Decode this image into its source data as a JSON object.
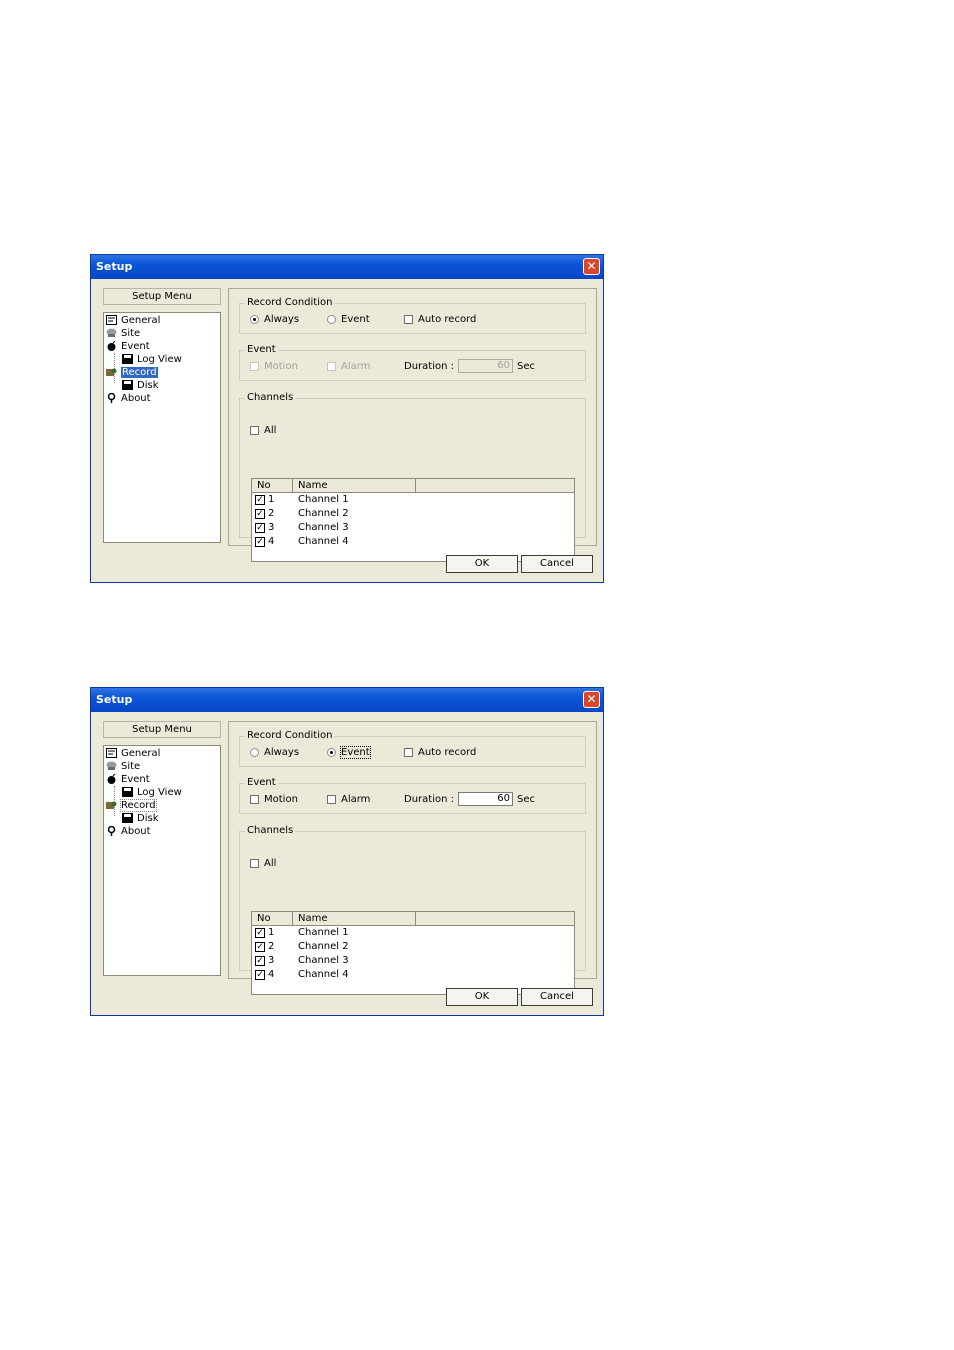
{
  "dialogs": [
    {
      "title": "Setup",
      "close_label": "✕",
      "setup_menu_label": "Setup Menu",
      "tree": [
        {
          "label": "General",
          "icon": "general-icon",
          "selected": false
        },
        {
          "label": "Site",
          "icon": "site-icon",
          "selected": false
        },
        {
          "label": "Event",
          "icon": "event-icon",
          "selected": false
        },
        {
          "label": "Log View",
          "icon": "disk-icon",
          "selected": false
        },
        {
          "label": "Record",
          "icon": "record-icon",
          "selected": true
        },
        {
          "label": "Disk",
          "icon": "disk-icon",
          "selected": false
        },
        {
          "label": "About",
          "icon": "about-icon",
          "selected": false
        }
      ],
      "record_condition": {
        "label": "Record Condition",
        "always": "Always",
        "event": "Event",
        "auto_record": "Auto record",
        "selected": "always"
      },
      "event": {
        "label": "Event",
        "motion": "Motion",
        "alarm": "Alarm",
        "duration_label": "Duration :",
        "duration_value": "60",
        "unit": "Sec",
        "enabled": false
      },
      "channels": {
        "label": "Channels",
        "all_label": "All",
        "headers": [
          "No",
          "Name"
        ],
        "rows": [
          {
            "no": "1",
            "name": "Channel 1",
            "checked": true
          },
          {
            "no": "2",
            "name": "Channel 2",
            "checked": true
          },
          {
            "no": "3",
            "name": "Channel 3",
            "checked": true
          },
          {
            "no": "4",
            "name": "Channel 4",
            "checked": true
          }
        ]
      },
      "ok_label": "OK",
      "cancel_label": "Cancel"
    },
    {
      "title": "Setup",
      "close_label": "✕",
      "setup_menu_label": "Setup Menu",
      "tree": [
        {
          "label": "General",
          "icon": "general-icon",
          "selected": false
        },
        {
          "label": "Site",
          "icon": "site-icon",
          "selected": false
        },
        {
          "label": "Event",
          "icon": "event-icon",
          "selected": false
        },
        {
          "label": "Log View",
          "icon": "disk-icon",
          "selected": false
        },
        {
          "label": "Record",
          "icon": "record-icon",
          "selected": false
        },
        {
          "label": "Disk",
          "icon": "disk-icon",
          "selected": false
        },
        {
          "label": "About",
          "icon": "about-icon",
          "selected": false
        }
      ],
      "record_condition": {
        "label": "Record Condition",
        "always": "Always",
        "event": "Event",
        "auto_record": "Auto record",
        "selected": "event"
      },
      "event": {
        "label": "Event",
        "motion": "Motion",
        "alarm": "Alarm",
        "duration_label": "Duration :",
        "duration_value": "60",
        "unit": "Sec",
        "enabled": true
      },
      "channels": {
        "label": "Channels",
        "all_label": "All",
        "headers": [
          "No",
          "Name"
        ],
        "rows": [
          {
            "no": "1",
            "name": "Channel 1",
            "checked": true
          },
          {
            "no": "2",
            "name": "Channel 2",
            "checked": true
          },
          {
            "no": "3",
            "name": "Channel 3",
            "checked": true
          },
          {
            "no": "4",
            "name": "Channel 4",
            "checked": true
          }
        ]
      },
      "ok_label": "OK",
      "cancel_label": "Cancel"
    }
  ],
  "colors": {
    "titlebar": "#0a56d8",
    "dialog_bg": "#ece9d8",
    "selection": "#316ac5",
    "close_button": "#d9462c"
  }
}
